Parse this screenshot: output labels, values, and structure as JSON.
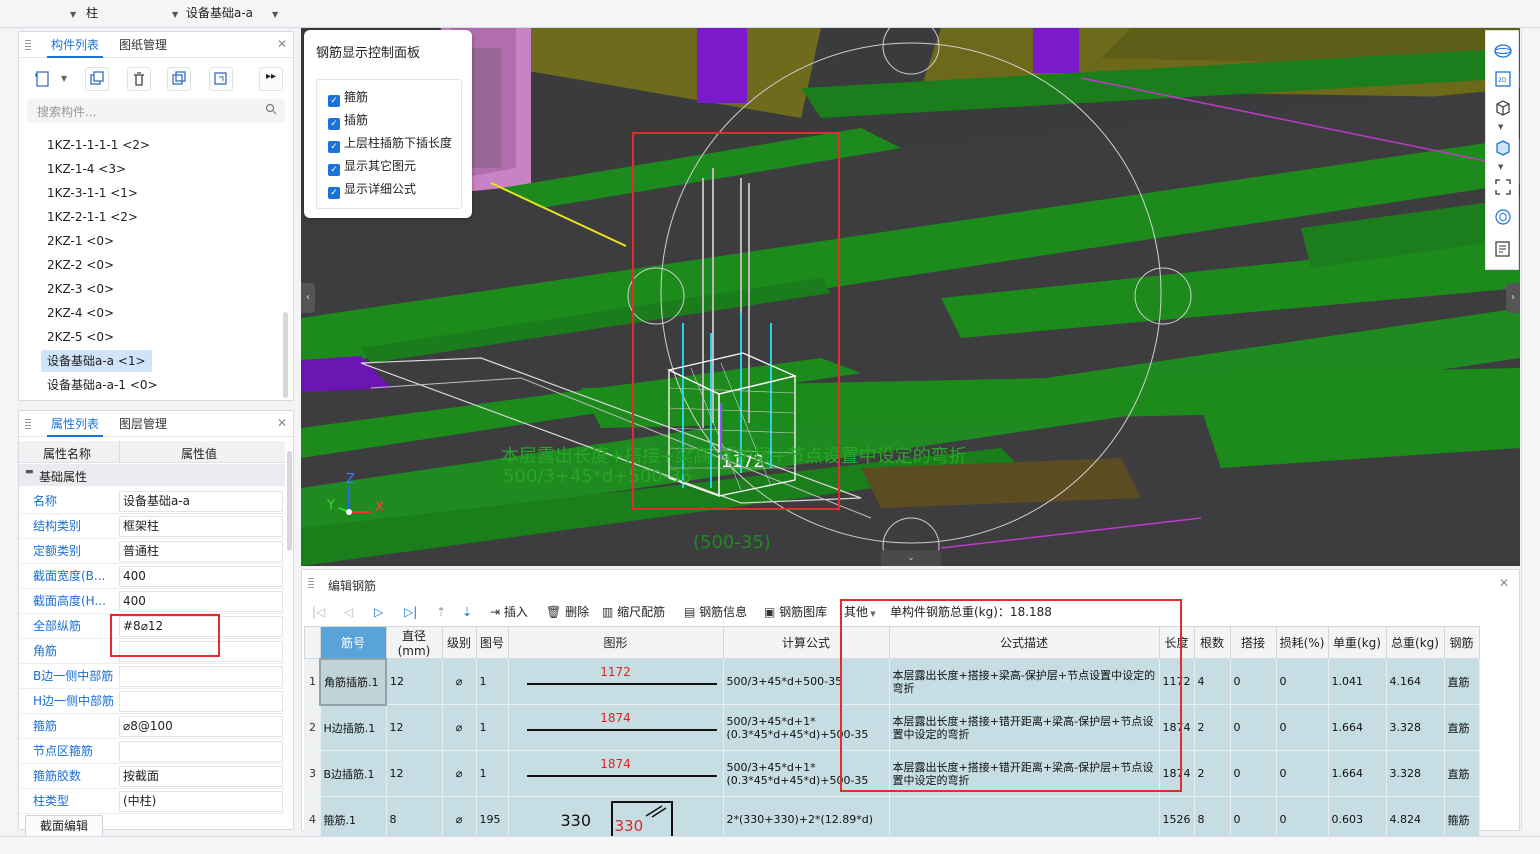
{
  "topbar": {
    "dropdown1_value": "柱",
    "dropdown2_value": "设备基础a-a"
  },
  "component_panel": {
    "tabs": [
      "构件列表",
      "图纸管理"
    ],
    "search_placeholder": "搜索构件...",
    "items": [
      {
        "label": "1KZ-1-1-1-1 <2>",
        "selected": false
      },
      {
        "label": "1KZ-1-4 <3>",
        "selected": false
      },
      {
        "label": "1KZ-3-1-1 <1>",
        "selected": false
      },
      {
        "label": "1KZ-2-1-1 <2>",
        "selected": false
      },
      {
        "label": "2KZ-1 <0>",
        "selected": false
      },
      {
        "label": "2KZ-2 <0>",
        "selected": false
      },
      {
        "label": "2KZ-3 <0>",
        "selected": false
      },
      {
        "label": "2KZ-4 <0>",
        "selected": false
      },
      {
        "label": "2KZ-5 <0>",
        "selected": false
      },
      {
        "label": "设备基础a-a <1>",
        "selected": true
      },
      {
        "label": "设备基础a-a-1 <0>",
        "selected": false
      }
    ]
  },
  "property_panel": {
    "tabs": [
      "属性列表",
      "图层管理"
    ],
    "col_name": "属性名称",
    "col_value": "属性值",
    "group": "基础属性",
    "rows": [
      {
        "name": "名称",
        "value": "设备基础a-a"
      },
      {
        "name": "结构类别",
        "value": "框架柱"
      },
      {
        "name": "定额类别",
        "value": "普通柱"
      },
      {
        "name": "截面宽度(B...",
        "value": "400"
      },
      {
        "name": "截面高度(H...",
        "value": "400"
      },
      {
        "name": "全部纵筋",
        "value": "#8⌀12"
      },
      {
        "name": "角筋",
        "value": ""
      },
      {
        "name": "B边一侧中部筋",
        "value": ""
      },
      {
        "name": "H边一侧中部筋",
        "value": ""
      },
      {
        "name": "箍筋",
        "value": "⌀8@100"
      },
      {
        "name": "节点区箍筋",
        "value": ""
      },
      {
        "name": "箍筋胶数",
        "value": "按截面"
      },
      {
        "name": "柱类型",
        "value": "(中柱)"
      }
    ],
    "section_edit_label": "截面编辑"
  },
  "control_panel": {
    "title": "钢筋显示控制面板",
    "options": [
      {
        "label": "箍筋",
        "checked": true
      },
      {
        "label": "插筋",
        "checked": true
      },
      {
        "label": "上层柱插筋下插长度",
        "checked": true
      },
      {
        "label": "显示其它图元",
        "checked": true
      },
      {
        "label": "显示详细公式",
        "checked": true
      }
    ]
  },
  "viewport": {
    "dim_label": "1172",
    "overlay_text_1": "本层露出长度+搭接+梁高-保护层+节点设置中设定的弯折",
    "overlay_text_2": "500/3+45*d+500-35",
    "overlay_text_3": "(500-35)",
    "axis_x": "X",
    "axis_y": "Y",
    "axis_z": "Z"
  },
  "rebar_panel": {
    "title": "编辑钢筋",
    "toolbar": {
      "insert": "插入",
      "delete": "删除",
      "scale": "缩尺配筋",
      "info": "钢筋信息",
      "library": "钢筋图库",
      "other": "其他",
      "total_weight": "单构件钢筋总重(kg)：18.188"
    },
    "columns": [
      "筋号",
      "直径(mm)",
      "级别",
      "图号",
      "图形",
      "计算公式",
      "公式描述",
      "长度",
      "根数",
      "搭接",
      "损耗(%)",
      "单重(kg)",
      "总重(kg)",
      "钢筋"
    ],
    "rows": [
      {
        "num": "1",
        "name": "角筋插筋.1",
        "diameter": "12",
        "grade": "⌀",
        "fig": "1",
        "shape_value": "1172",
        "formula": "500/3+45*d+500-35",
        "desc": "本层露出长度+搭接+梁高-保护层+节点设置中设定的弯折",
        "length": "1172",
        "count": "4",
        "lap": "0",
        "loss": "0",
        "unit_w": "1.041",
        "total_w": "4.164",
        "type": "直筋"
      },
      {
        "num": "2",
        "name": "H边插筋.1",
        "diameter": "12",
        "grade": "⌀",
        "fig": "1",
        "shape_value": "1874",
        "formula": "500/3+45*d+1*(0.3*45*d+45*d)+500-35",
        "desc": "本层露出长度+搭接+错开距离+梁高-保护层+节点设置中设定的弯折",
        "length": "1874",
        "count": "2",
        "lap": "0",
        "loss": "0",
        "unit_w": "1.664",
        "total_w": "3.328",
        "type": "直筋"
      },
      {
        "num": "3",
        "name": "B边插筋.1",
        "diameter": "12",
        "grade": "⌀",
        "fig": "1",
        "shape_value": "1874",
        "formula": "500/3+45*d+1*(0.3*45*d+45*d)+500-35",
        "desc": "本层露出长度+搭接+错开距离+梁高-保护层+节点设置中设定的弯折",
        "length": "1874",
        "count": "2",
        "lap": "0",
        "loss": "0",
        "unit_w": "1.664",
        "total_w": "3.328",
        "type": "直筋"
      },
      {
        "num": "4",
        "name": "箍筋.1",
        "diameter": "8",
        "grade": "⌀",
        "fig": "195",
        "shape_value": "330",
        "shape_value2": "330",
        "formula": "2*(330+330)+2*(12.89*d)",
        "desc": "",
        "length": "1526",
        "count": "8",
        "lap": "0",
        "loss": "0",
        "unit_w": "0.603",
        "total_w": "4.824",
        "type": "箍筋"
      }
    ]
  },
  "colors": {
    "accent": "#1a73d9",
    "highlight": "#e52b2b",
    "grid_row": "#c6dee3",
    "viewport_bg": "#3a3b3d",
    "green": "#1f8a1f"
  }
}
